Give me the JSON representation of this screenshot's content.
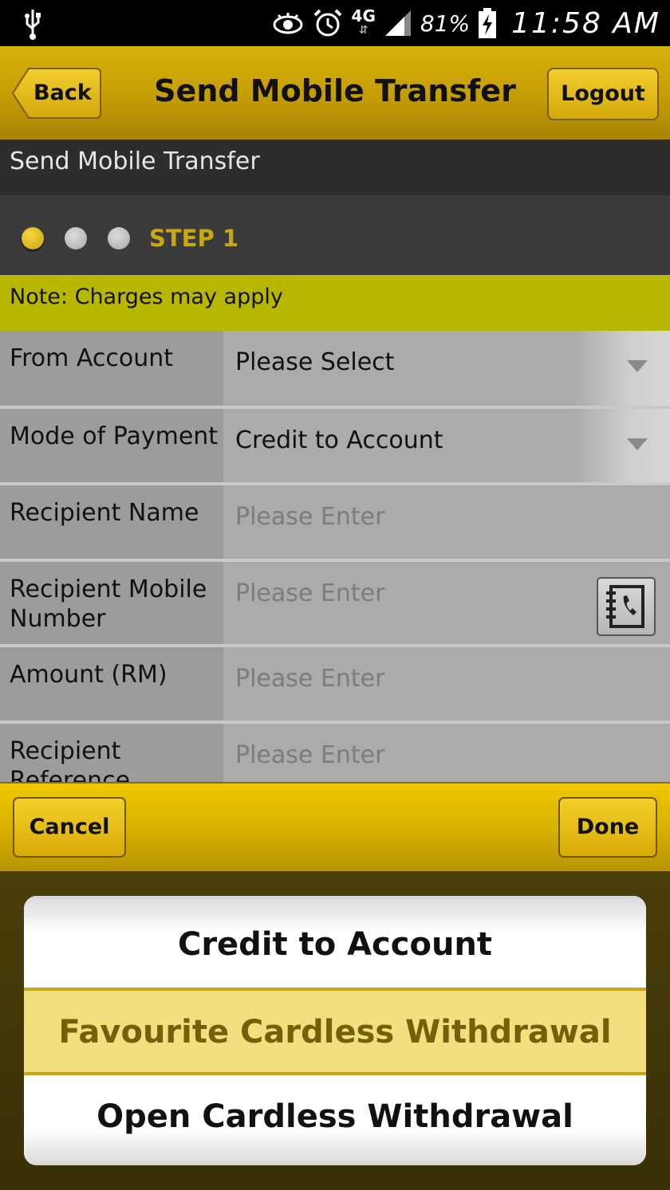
{
  "status_bar": {
    "network": "4G",
    "battery": "81%",
    "time": "11:58 AM"
  },
  "header": {
    "back_label": "Back",
    "title": "Send Mobile Transfer",
    "logout_label": "Logout"
  },
  "subheader": "Send Mobile Transfer",
  "steps": {
    "label": "STEP 1",
    "current": 1,
    "total": 3
  },
  "note": "Note: Charges may apply",
  "form": {
    "from_account": {
      "label": "From Account",
      "value": "Please Select"
    },
    "mode_of_payment": {
      "label": "Mode of Payment",
      "value": "Credit to Account"
    },
    "recipient_name": {
      "label": "Recipient Name",
      "placeholder": "Please Enter"
    },
    "recipient_mobile": {
      "label": "Recipient Mobile Number",
      "placeholder": "Please Enter"
    },
    "amount": {
      "label": "Amount (RM)",
      "placeholder": "Please Enter"
    },
    "recipient_reference": {
      "label": "Recipient Reference",
      "placeholder": "Please Enter"
    }
  },
  "picker": {
    "cancel_label": "Cancel",
    "done_label": "Done",
    "options": [
      "Credit to Account",
      "Favourite Cardless Withdrawal",
      "Open Cardless Withdrawal"
    ],
    "selected_index": 1
  },
  "colors": {
    "accent": "#d4ae0a",
    "note_bg": "#b7b700",
    "step_active": "#c9a710",
    "selected_option_bg": "#f4df7e"
  }
}
